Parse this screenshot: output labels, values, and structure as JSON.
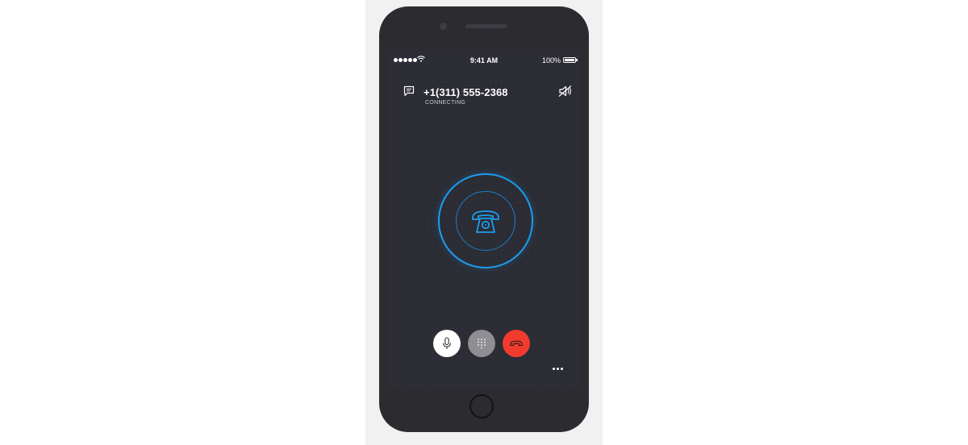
{
  "status_bar": {
    "time": "9:41 AM",
    "battery_text": "100%",
    "icons": [
      "signal-dots-icon",
      "wifi-icon",
      "battery-icon"
    ]
  },
  "call": {
    "number": "+1(311) 555-2368",
    "status": "CONNECTING"
  },
  "icons": {
    "chat": "chat-bubble-icon",
    "speaker": "speaker-muted-icon",
    "center": "rotary-phone-icon",
    "mic": "microphone-icon",
    "keypad": "keypad-icon",
    "hangup": "hang-up-icon",
    "more": "more-dots-icon"
  },
  "colors": {
    "accent": "#1c9cef",
    "screen_bg": "#2b2c34",
    "hangup": "#f23b2f",
    "keypad_btn": "#8e8e93",
    "mic_btn": "#ffffff"
  }
}
